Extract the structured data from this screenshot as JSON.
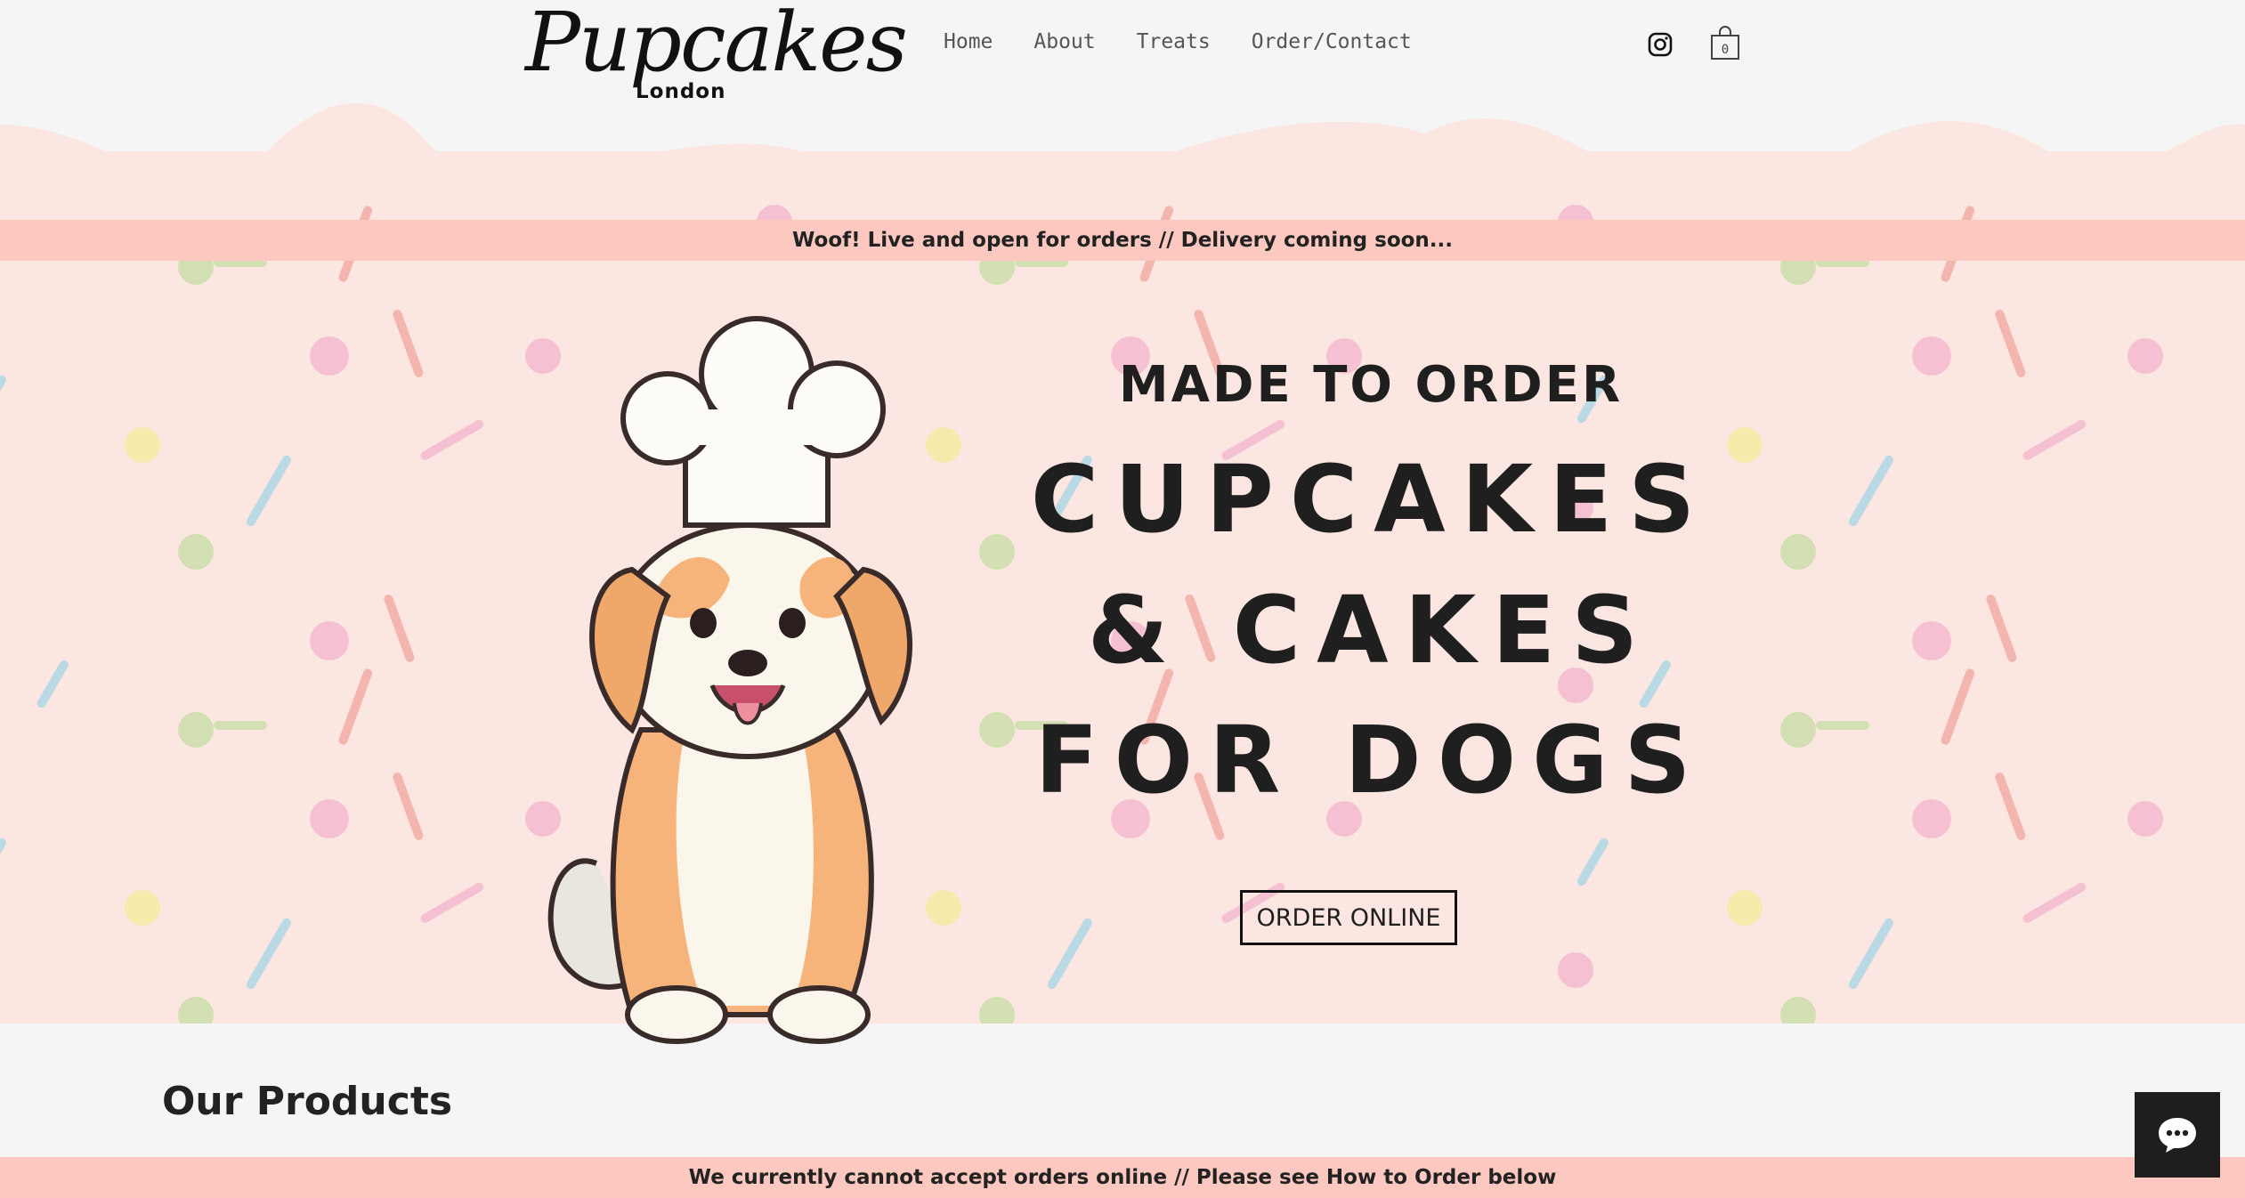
{
  "header": {
    "logo_main": "Pupcakes",
    "logo_sub": "London",
    "nav": [
      "Home",
      "About",
      "Treats",
      "Order/Contact"
    ],
    "instagram_icon": "instagram-icon",
    "cart_icon": "shopping-bag-icon",
    "cart_count": "0"
  },
  "hero": {
    "announcement": "Woof! Live and open for orders // Delivery coming soon...",
    "line1": "MADE TO ORDER",
    "line2": "CUPCAKES",
    "line3": "& CAKES",
    "line4": "FOR DOGS",
    "cta": "ORDER ONLINE",
    "illustration": "chef-puppy-illustration"
  },
  "products": {
    "title": "Our Products",
    "notice": "We currently cannot accept orders online // Please see How to Order below"
  },
  "chat": {
    "icon": "chat-bubble-icon"
  },
  "colors": {
    "page_bg": "#f5f5f5",
    "hero_bg": "#fbe6e1",
    "banner": "#fcc8c0",
    "text": "#1f1f1f",
    "chat_bg": "#1e1e1e"
  }
}
